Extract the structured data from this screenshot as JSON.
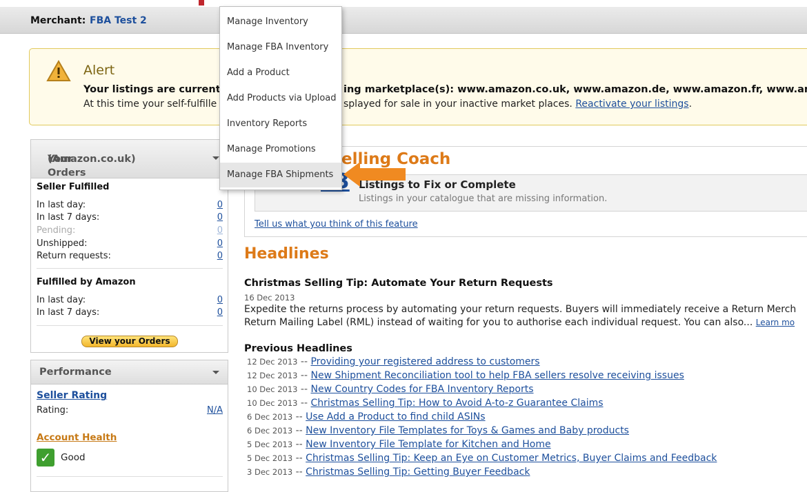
{
  "merchant": {
    "label": "Merchant:",
    "name": "FBA Test 2"
  },
  "alert": {
    "title": "Alert",
    "line1_start": "Your listings are currenth",
    "line1_end": "ing marketplace(s): www.amazon.co.uk, www.amazon.de, www.amazon.fr, www.am",
    "line2_start": "At this time your self-fulfille",
    "line2_end": "splayed for sale in your inactive market places.",
    "link": "Reactivate your listings",
    "line2_tail": "."
  },
  "dropdown": {
    "items": [
      "Manage Inventory",
      "Manage FBA Inventory",
      "Add a Product",
      "Add Products via Upload",
      "Inventory Reports",
      "Manage Promotions",
      "Manage FBA Shipments"
    ]
  },
  "orders": {
    "title_line1": "Your Orders",
    "title_line2": "(Amazon.co.uk)",
    "seller_fulfilled": {
      "title": "Seller Fulfilled",
      "rows": [
        {
          "label": "In last day:",
          "value": "0"
        },
        {
          "label": "In last 7 days:",
          "value": "0"
        },
        {
          "label": "Pending:",
          "value": "0"
        },
        {
          "label": "Unshipped:",
          "value": "0"
        },
        {
          "label": "Return requests:",
          "value": "0"
        }
      ]
    },
    "fba": {
      "title": "Fulfilled by Amazon",
      "rows": [
        {
          "label": "In last day:",
          "value": "0"
        },
        {
          "label": "In last 7 days:",
          "value": "0"
        }
      ]
    },
    "view_button": "View your Orders"
  },
  "performance": {
    "title": "Performance",
    "seller_rating": "Seller Rating",
    "rating_label": "Rating:",
    "rating_value": "N/A",
    "account_health": "Account Health",
    "health_status": "Good"
  },
  "coach": {
    "title": "elling Coach",
    "count": "63",
    "item_title": "Listings to Fix or Complete",
    "item_desc": "Listings in your catalogue that are missing information.",
    "feedback_link": "Tell us what you think of this feature"
  },
  "headlines": {
    "title": "Headlines",
    "lead_title": "Christmas Selling Tip: Automate Your Return Requests",
    "lead_date": "16 Dec 2013",
    "lead_body1": "Expedite the returns process by automating your return requests. Buyers will immediately receive a Return Merch",
    "lead_body2": "Return Mailing Label (RML) instead of waiting for you to authorise each individual request. You can also...",
    "learn_more": "Learn mo",
    "previous_title": "Previous Headlines",
    "previous": [
      {
        "date": "12 Dec 2013",
        "text": "Providing your registered address to customers"
      },
      {
        "date": "12 Dec 2013",
        "text": "New Shipment Reconciliation tool to help FBA sellers resolve receiving issues"
      },
      {
        "date": "10 Dec 2013",
        "text": "New Country Codes for FBA Inventory Reports"
      },
      {
        "date": "10 Dec 2013",
        "text": "Christmas Selling Tip: How to Avoid A-to-z Guarantee Claims"
      },
      {
        "date": "6 Dec 2013",
        "text": "Use Add a Product to find child ASINs"
      },
      {
        "date": "6 Dec 2013",
        "text": "New Inventory File Templates for Toys & Games and Baby products"
      },
      {
        "date": "5 Dec 2013",
        "text": "New Inventory File Template for Kitchen and Home"
      },
      {
        "date": "5 Dec 2013",
        "text": "Christmas Selling Tip: Keep an Eye on Customer Metrics, Buyer Claims and Feedback"
      },
      {
        "date": "3 Dec 2013",
        "text": "Christmas Selling Tip: Getting Buyer Feedback"
      }
    ],
    "separator": "--"
  },
  "colors": {
    "accent_orange": "#dd7a18",
    "link_blue": "#1d4f9c",
    "alert_border": "#e1c95c",
    "check_green": "#3f9f2f"
  },
  "icons": [
    "warning-icon",
    "chevron-down-icon",
    "checkmark-icon",
    "arrow-left-icon"
  ]
}
